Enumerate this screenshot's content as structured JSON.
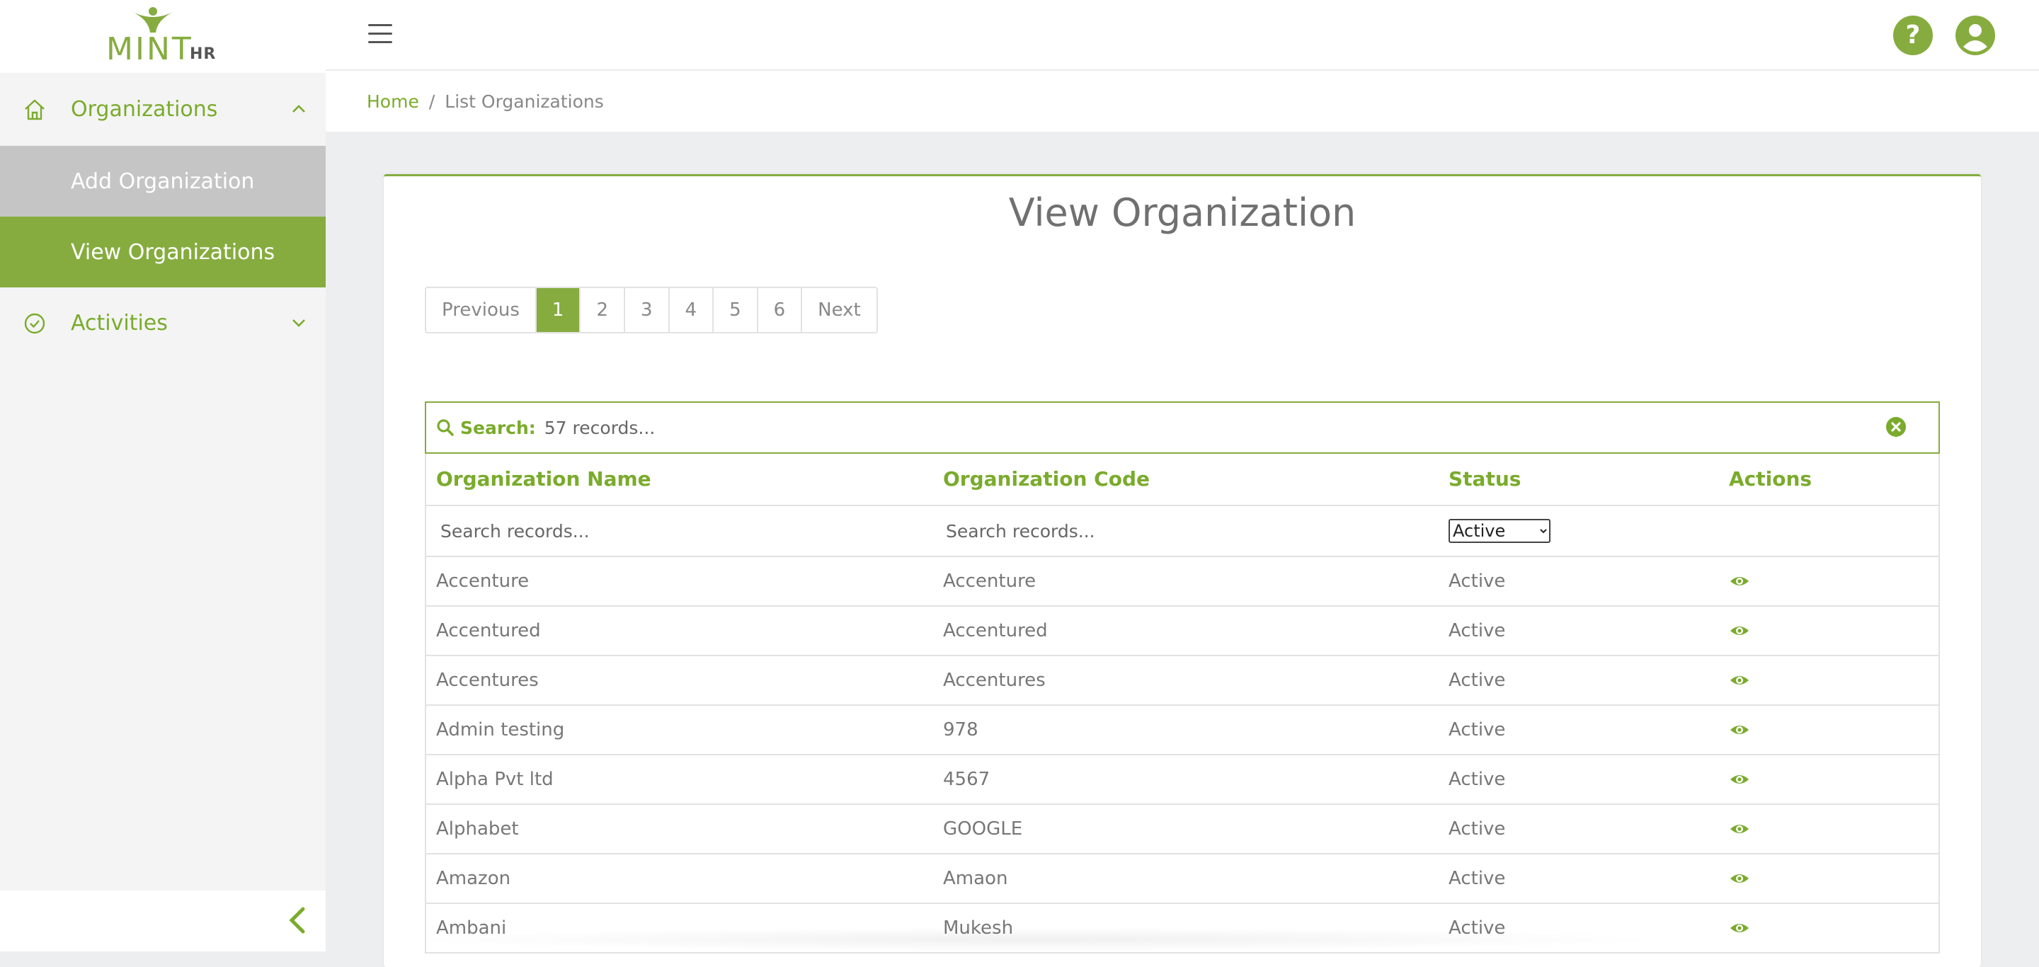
{
  "brand": {
    "name": "MINT",
    "suffix": "HR"
  },
  "sidebar": {
    "items": [
      {
        "label": "Organizations",
        "icon": "home-icon",
        "expanded": true
      },
      {
        "label": "Add Organization"
      },
      {
        "label": "View Organizations",
        "active": true
      },
      {
        "label": "Activities",
        "icon": "check-circle-icon",
        "expanded": false
      }
    ]
  },
  "topbar": {
    "help_label": "?"
  },
  "breadcrumb": {
    "home": "Home",
    "separator": "/",
    "current": "List Organizations"
  },
  "page": {
    "title": "View Organization"
  },
  "pagination": {
    "previous": "Previous",
    "pages": [
      "1",
      "2",
      "3",
      "4",
      "5",
      "6"
    ],
    "current": "1",
    "next": "Next"
  },
  "search": {
    "label": "Search:",
    "placeholder": "57 records..."
  },
  "table": {
    "columns": [
      "Organization Name",
      "Organization Code",
      "Status",
      "Actions"
    ],
    "filter_placeholder": "Search records...",
    "status_filter": {
      "selected": "Active"
    },
    "rows": [
      {
        "name": "Accenture",
        "code": "Accenture",
        "status": "Active"
      },
      {
        "name": "Accentured",
        "code": "Accentured",
        "status": "Active"
      },
      {
        "name": "Accentures",
        "code": "Accentures",
        "status": "Active"
      },
      {
        "name": "Admin testing",
        "code": "978",
        "status": "Active"
      },
      {
        "name": "Alpha Pvt ltd",
        "code": "4567",
        "status": "Active"
      },
      {
        "name": "Alphabet",
        "code": "GOOGLE",
        "status": "Active"
      },
      {
        "name": "Amazon",
        "code": "Amaon",
        "status": "Active"
      },
      {
        "name": "Ambani",
        "code": "Mukesh",
        "status": "Active"
      }
    ]
  },
  "colors": {
    "accent": "#86ac3f",
    "accent_text": "#7aab2c",
    "sidebar_bg": "#f4f4f4",
    "content_bg": "#eceeef"
  }
}
